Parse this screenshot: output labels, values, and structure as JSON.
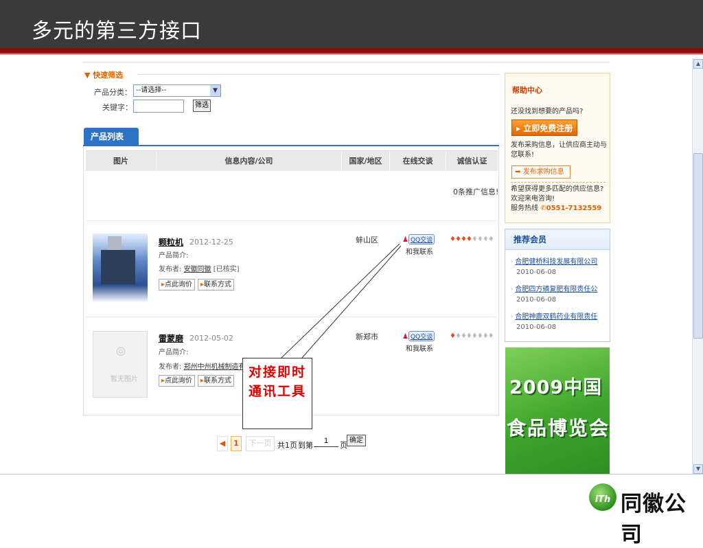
{
  "slide": {
    "title": "多元的第三方接口",
    "callout": "对接即时通讯工具",
    "company": "同徽公司",
    "logo_mark": "iTh"
  },
  "filter": {
    "title": "快速筛选",
    "category_label": "产品分类：",
    "category_value": "--请选择--",
    "keyword_label": "关键字：",
    "keyword_value": "",
    "filter_button": "筛选"
  },
  "list": {
    "tab": "产品列表",
    "columns": [
      "图片",
      "信息内容/公司",
      "国家/地区",
      "在线交谈",
      "诚信认证"
    ],
    "no_promo": "0条推广信息!",
    "items": [
      {
        "name": "颗粒机",
        "date": "2012-12-25",
        "intro": "产品简介:",
        "publisher_label": "发布者:",
        "publisher": "安徽同徽",
        "verified": "[已核实]",
        "inquiry": "点此询价",
        "contact": "联系方式",
        "region": "蚌山区",
        "qq_label": "QQ交谈",
        "contact_me": "和我联系",
        "rating_on": 4,
        "rating_total": 8
      },
      {
        "name": "雷蒙磨",
        "date": "2012-05-02",
        "intro": "产品简介:",
        "publisher_label": "发布者:",
        "publisher": "郑州中州机械制造有",
        "inquiry": "点此询价",
        "contact": "联系方式",
        "region": "新郑市",
        "qq_label": "QQ交谈",
        "contact_me": "和我联系",
        "placeholder_text": "暂无图片",
        "rating_on": 1,
        "rating_total": 8
      }
    ]
  },
  "pager": {
    "prev": "◀",
    "current": "1",
    "next": "下一页",
    "total": "共1页",
    "goto": "到第",
    "goto_value": "1",
    "unit": "页",
    "ok": "确定"
  },
  "help": {
    "title": "帮助中心",
    "q1": "还没找到想要的产品吗?",
    "register": "立即免费注册",
    "p2": "发布采购信息，让供应商主动与您联系!",
    "publish": "发布求购信息",
    "p3": "希望获得更多匹配的供应信息?欢迎来电咨询!",
    "hotline_label": "服务热线",
    "hotline": "0551-7132559"
  },
  "members": {
    "title": "推荐会员",
    "items": [
      {
        "name": "合肥健桥科技发展有限公司",
        "date": "2010-06-08"
      },
      {
        "name": "合肥四方磷复肥有限责任公",
        "date": "2010-06-08"
      },
      {
        "name": "合肥神鹿双鹤药业有限责任",
        "date": "2010-06-08"
      }
    ]
  },
  "banner": {
    "line1": "2009中国",
    "line2": "食品博览会"
  }
}
